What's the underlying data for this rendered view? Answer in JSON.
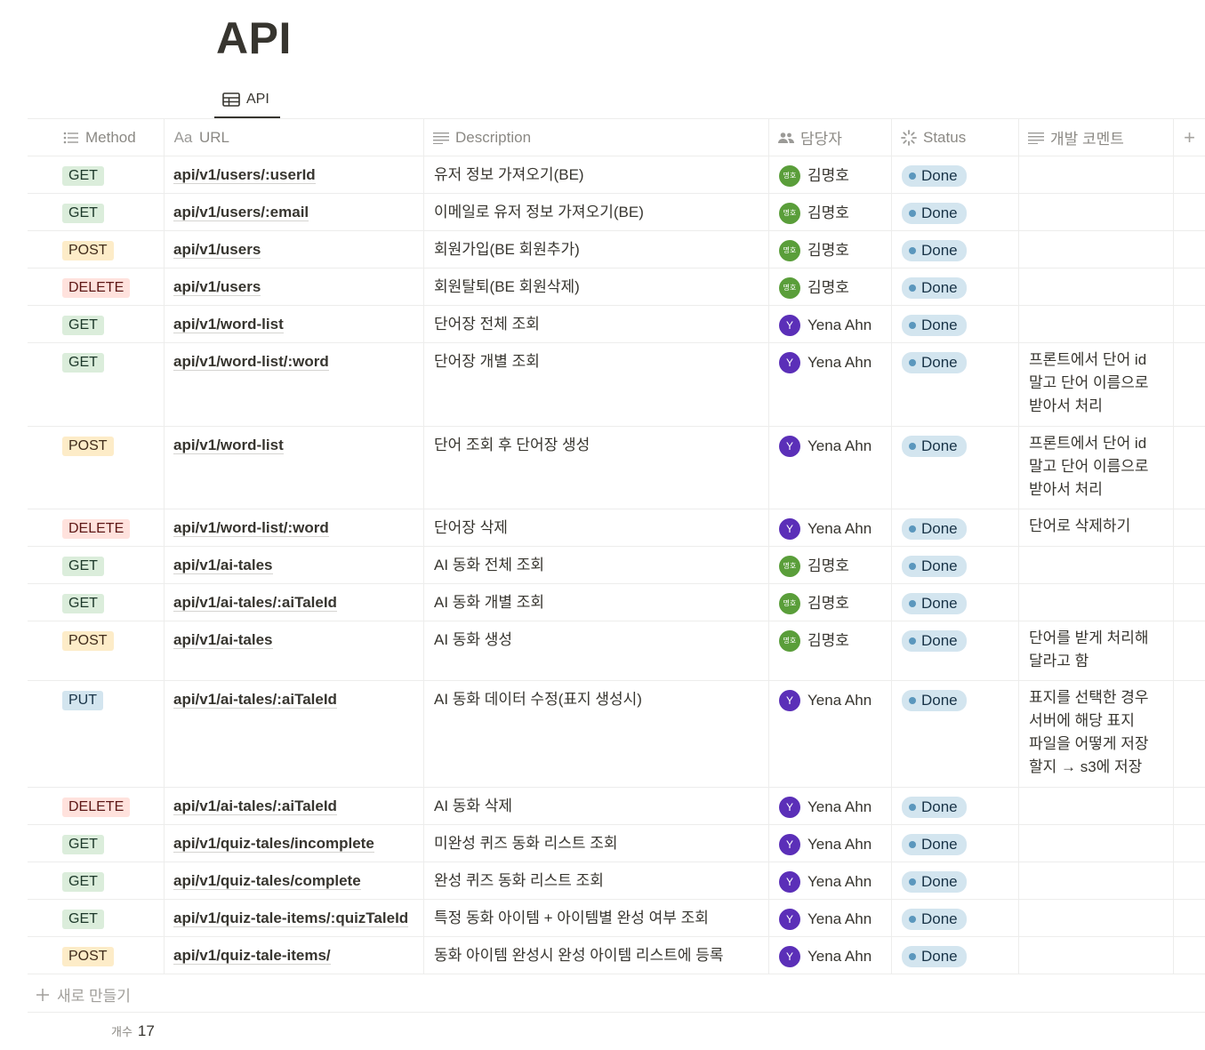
{
  "page": {
    "title": "API"
  },
  "view": {
    "tab_label": "API"
  },
  "columns": {
    "method": "Method",
    "url": "URL",
    "description": "Description",
    "owner": "담당자",
    "status": "Status",
    "comment": "개발 코멘트",
    "add": "+"
  },
  "rows": [
    {
      "method": "GET",
      "url": "api/v1/users/:userId",
      "description": "유저 정보 가져오기(BE)",
      "owner": "김명호",
      "avatar": "명호",
      "status": "Done",
      "comment": ""
    },
    {
      "method": "GET",
      "url": "api/v1/users/:email",
      "description": "이메일로 유저 정보 가져오기(BE)",
      "owner": "김명호",
      "avatar": "명호",
      "status": "Done",
      "comment": ""
    },
    {
      "method": "POST",
      "url": "api/v1/users",
      "description": "회원가입(BE 회원추가)",
      "owner": "김명호",
      "avatar": "명호",
      "status": "Done",
      "comment": ""
    },
    {
      "method": "DELETE",
      "url": "api/v1/users",
      "description": "회원탈퇴(BE 회원삭제)",
      "owner": "김명호",
      "avatar": "명호",
      "status": "Done",
      "comment": ""
    },
    {
      "method": "GET",
      "url": "api/v1/word-list",
      "description": "단어장 전체 조회",
      "owner": "Yena Ahn",
      "avatar": "Y",
      "status": "Done",
      "comment": ""
    },
    {
      "method": "GET",
      "url": "api/v1/word-list/:word",
      "description": "단어장 개별 조회",
      "owner": "Yena Ahn",
      "avatar": "Y",
      "status": "Done",
      "comment": "프론트에서 단어 id\n말고 단어 이름으로\n받아서 처리"
    },
    {
      "method": "POST",
      "url": "api/v1/word-list",
      "description": "단어 조회 후 단어장 생성",
      "owner": "Yena Ahn",
      "avatar": "Y",
      "status": "Done",
      "comment": "프론트에서 단어 id\n말고 단어 이름으로\n받아서 처리"
    },
    {
      "method": "DELETE",
      "url": "api/v1/word-list/:word",
      "description": "단어장 삭제",
      "owner": "Yena Ahn",
      "avatar": "Y",
      "status": "Done",
      "comment": "단어로 삭제하기"
    },
    {
      "method": "GET",
      "url": "api/v1/ai-tales",
      "description": "AI 동화 전체 조회",
      "owner": "김명호",
      "avatar": "명호",
      "status": "Done",
      "comment": ""
    },
    {
      "method": "GET",
      "url": "api/v1/ai-tales/:aiTaleId",
      "description": "AI 동화 개별 조회",
      "owner": "김명호",
      "avatar": "명호",
      "status": "Done",
      "comment": ""
    },
    {
      "method": "POST",
      "url": "api/v1/ai-tales",
      "description": "AI 동화 생성",
      "owner": "김명호",
      "avatar": "명호",
      "status": "Done",
      "comment": "단어를 받게 처리해\n달라고 함"
    },
    {
      "method": "PUT",
      "url": "api/v1/ai-tales/:aiTaleId",
      "description": "AI 동화 데이터 수정(표지 생성시)",
      "owner": "Yena Ahn",
      "avatar": "Y",
      "status": "Done",
      "comment": "표지를 선택한 경우\n서버에 해당 표지\n파일을 어떻게 저장\n할지 → s3에 저장"
    },
    {
      "method": "DELETE",
      "url": "api/v1/ai-tales/:aiTaleId",
      "description": "AI 동화 삭제",
      "owner": "Yena Ahn",
      "avatar": "Y",
      "status": "Done",
      "comment": ""
    },
    {
      "method": "GET",
      "url": "api/v1/quiz-tales/incomplete",
      "description": "미완성 퀴즈 동화 리스트 조회",
      "owner": "Yena Ahn",
      "avatar": "Y",
      "status": "Done",
      "comment": ""
    },
    {
      "method": "GET",
      "url": "api/v1/quiz-tales/complete",
      "description": "완성 퀴즈 동화 리스트 조회",
      "owner": "Yena Ahn",
      "avatar": "Y",
      "status": "Done",
      "comment": ""
    },
    {
      "method": "GET",
      "url": "api/v1/quiz-tale-items/:quizTaleId",
      "description": "특정 동화 아이템 + 아이템별 완성 여부 조회",
      "owner": "Yena Ahn",
      "avatar": "Y",
      "status": "Done",
      "comment": ""
    },
    {
      "method": "POST",
      "url": "api/v1/quiz-tale-items/",
      "description": "동화 아이템 완성시 완성 아이템 리스트에 등록",
      "owner": "Yena Ahn",
      "avatar": "Y",
      "status": "Done",
      "comment": ""
    }
  ],
  "footer": {
    "new_label": "새로 만들기",
    "count_label": "개수",
    "count_value": "17"
  },
  "colors": {
    "get_bg": "#dbeddb",
    "post_bg": "#fdecc8",
    "delete_bg": "#ffe2dd",
    "put_bg": "#d3e5ef",
    "status_bg": "#d3e5ef",
    "avatar_green": "#5a9e3a",
    "avatar_purple": "#5b2fb8"
  }
}
